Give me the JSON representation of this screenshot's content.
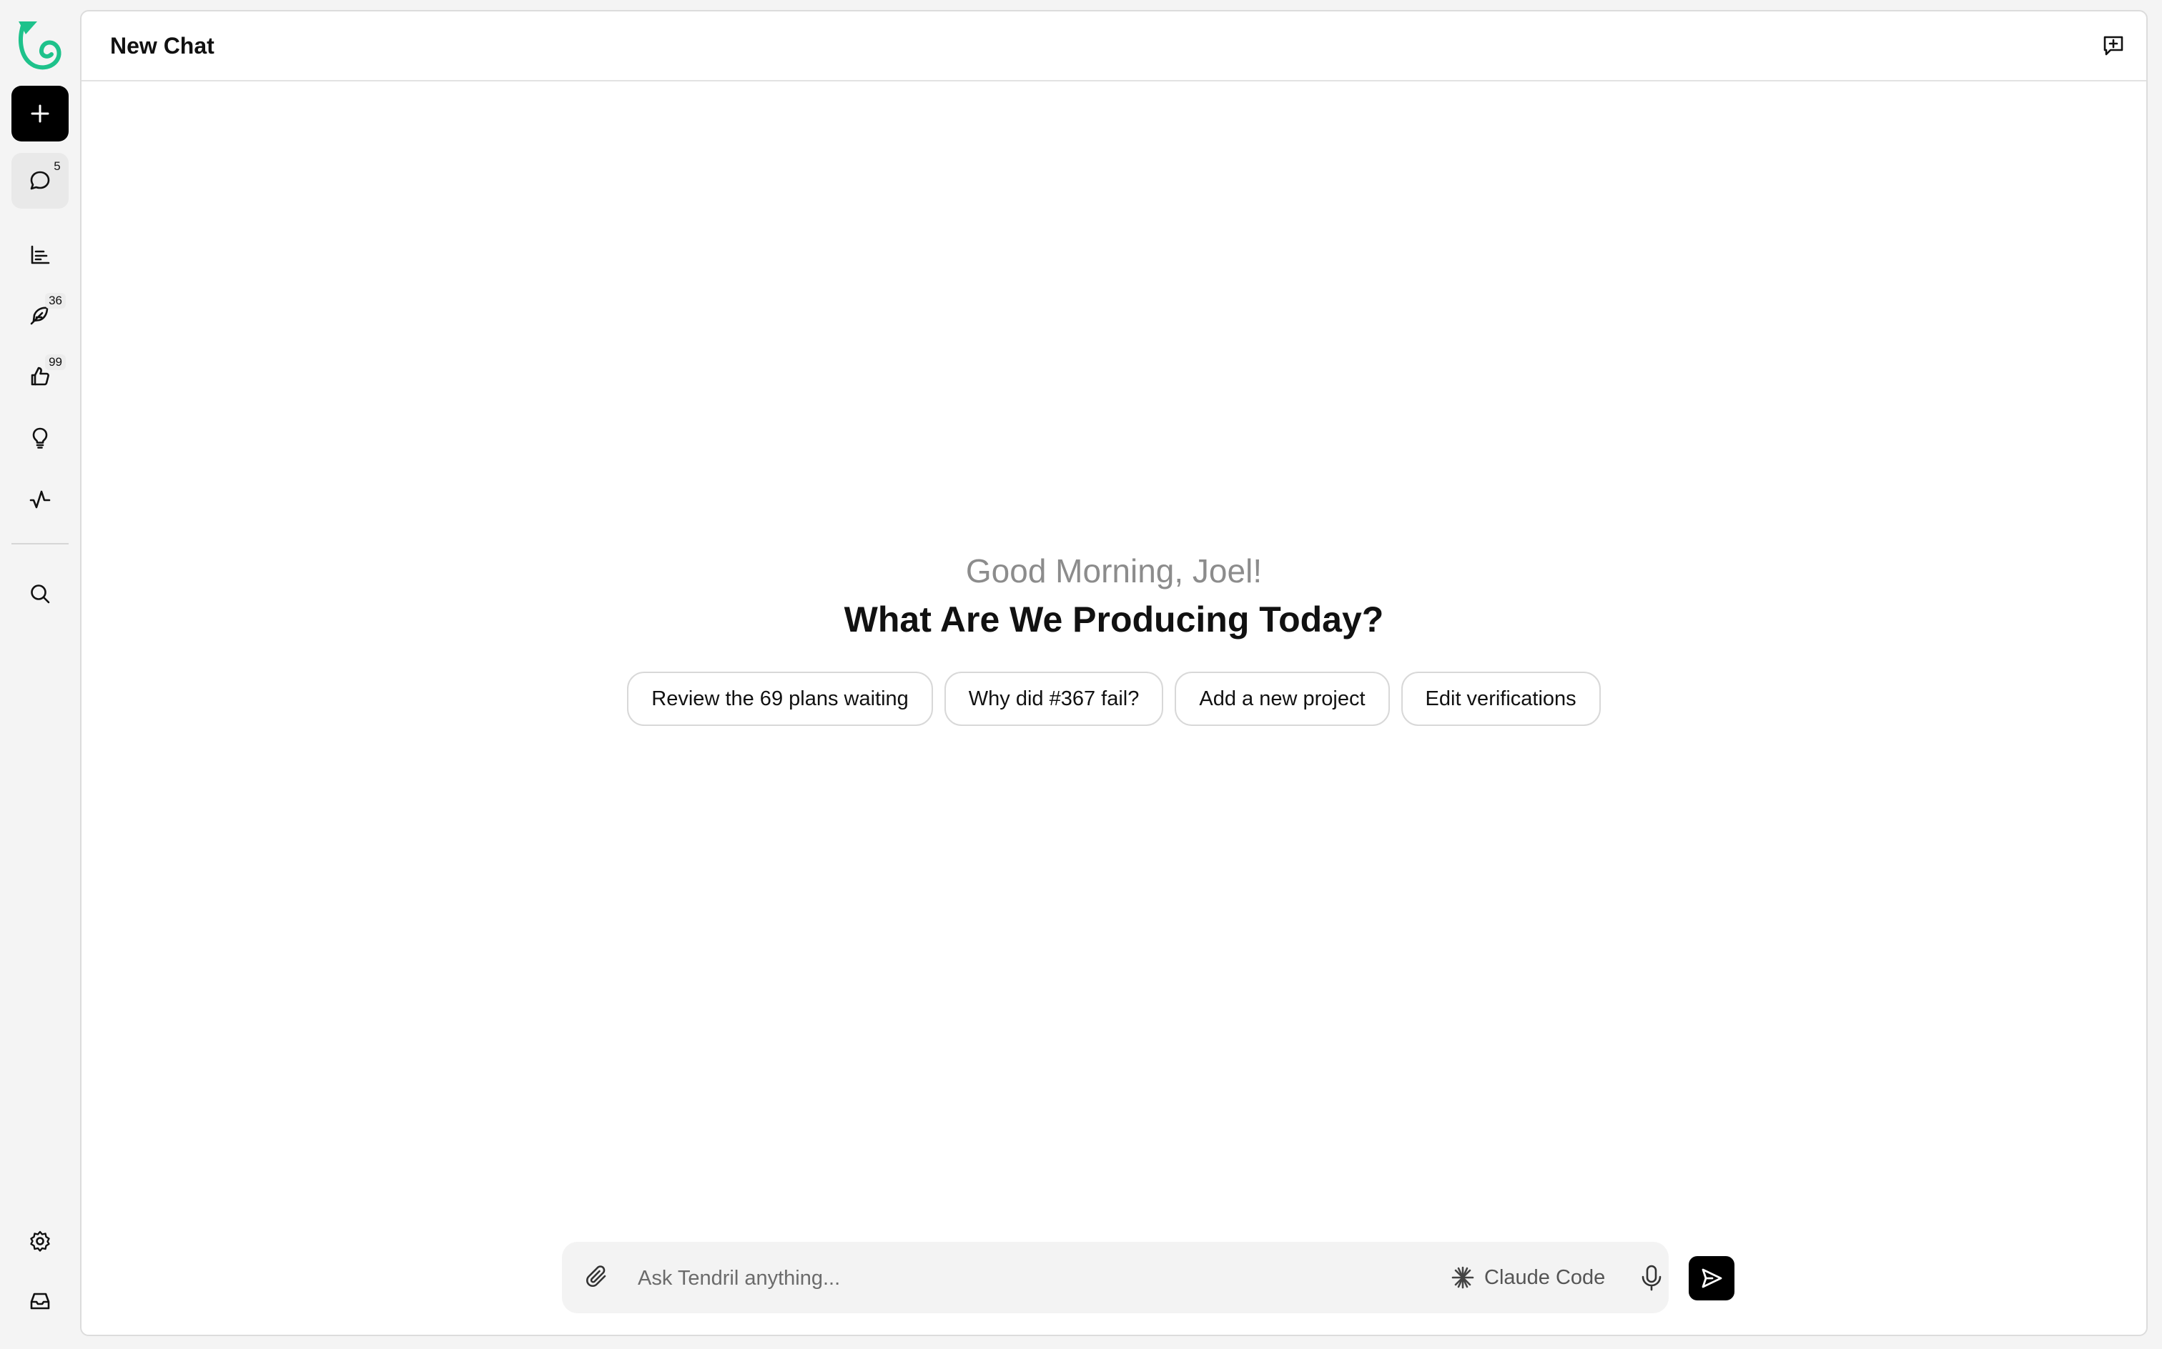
{
  "app": {
    "brand_color": "#1ec28b"
  },
  "sidebar": {
    "new_button": {
      "icon": "plus-icon"
    },
    "items": [
      {
        "id": "chats",
        "icon": "chat-bubble-icon",
        "badge": "5",
        "active": true
      },
      {
        "id": "analytics",
        "icon": "bar-chart-icon",
        "badge": ""
      },
      {
        "id": "plans",
        "icon": "feather-icon",
        "badge": "36"
      },
      {
        "id": "approvals",
        "icon": "thumbs-up-icon",
        "badge": "99"
      },
      {
        "id": "ideas",
        "icon": "lightbulb-icon",
        "badge": ""
      },
      {
        "id": "activity",
        "icon": "activity-icon",
        "badge": ""
      }
    ],
    "search": {
      "icon": "search-icon"
    },
    "footer": [
      {
        "id": "settings",
        "icon": "gear-icon"
      },
      {
        "id": "inbox",
        "icon": "inbox-icon"
      }
    ]
  },
  "header": {
    "title": "New Chat",
    "action_icon": "new-chat-icon"
  },
  "main": {
    "greeting": "Good Morning, Joel!",
    "headline": "What Are We Producing Today?",
    "suggestions": [
      "Review the 69 plans waiting",
      "Why did #367 fail?",
      "Add a new project",
      "Edit verifications"
    ]
  },
  "composer": {
    "placeholder": "Ask Tendril anything...",
    "value": "",
    "model": "Claude Code",
    "attach_icon": "paperclip-icon",
    "model_icon": "sparkle-icon",
    "mic_icon": "microphone-icon",
    "send_icon": "send-icon"
  }
}
